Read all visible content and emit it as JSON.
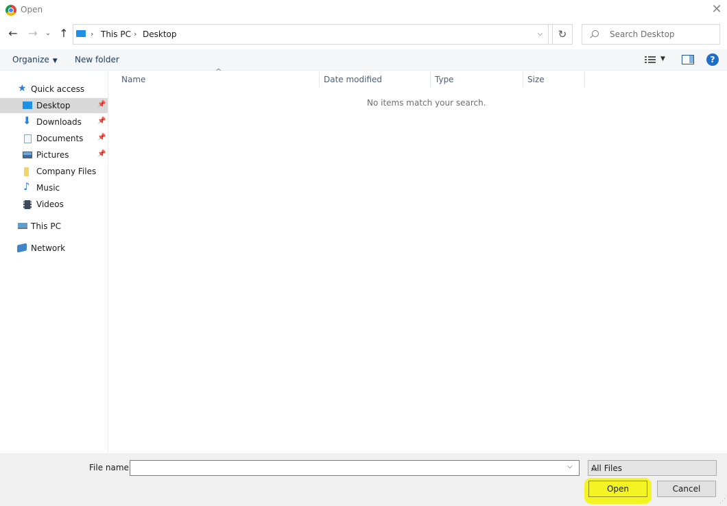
{
  "window": {
    "title": "Open"
  },
  "address": {
    "segments": [
      "This PC",
      "Desktop"
    ]
  },
  "search": {
    "placeholder": "Search Desktop"
  },
  "toolbar": {
    "organize_label": "Organize",
    "new_folder_label": "New folder"
  },
  "sidebar": {
    "items": [
      {
        "label": "Quick access",
        "icon": "star-icon"
      },
      {
        "label": "Desktop",
        "icon": "desktop-icon",
        "selected": true,
        "pinned": true
      },
      {
        "label": "Downloads",
        "icon": "download-icon",
        "pinned": true
      },
      {
        "label": "Documents",
        "icon": "document-icon",
        "pinned": true
      },
      {
        "label": "Pictures",
        "icon": "pictures-icon",
        "pinned": true
      },
      {
        "label": "Company Files",
        "icon": "folder-icon"
      },
      {
        "label": "Music",
        "icon": "music-icon"
      },
      {
        "label": "Videos",
        "icon": "videos-icon"
      },
      {
        "label": "This PC",
        "icon": "computer-icon"
      },
      {
        "label": "Network",
        "icon": "network-icon"
      }
    ]
  },
  "columns": [
    "Name",
    "Date modified",
    "Type",
    "Size"
  ],
  "content": {
    "empty_message": "No items match your search."
  },
  "footer": {
    "file_name_label": "File name:",
    "file_name_value": "",
    "file_type_selected": "All Files",
    "open_label": "Open",
    "cancel_label": "Cancel"
  },
  "colors": {
    "accent": "#1e90e6",
    "highlight": "#f5f500",
    "help": "#1d6fc7"
  }
}
